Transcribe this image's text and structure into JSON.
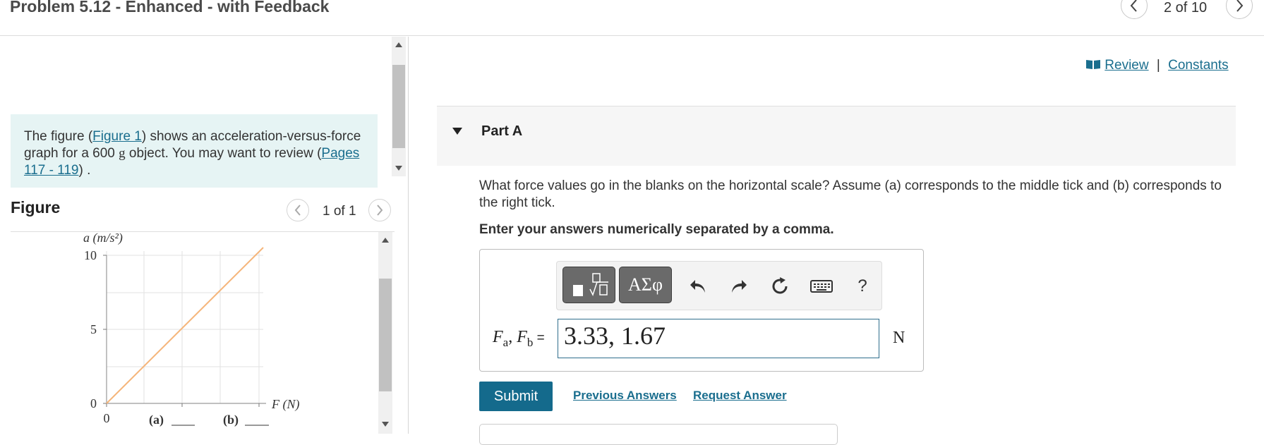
{
  "header": {
    "title": "Problem 5.12 - Enhanced - with Feedback",
    "counter": "2 of 10"
  },
  "intro": {
    "text_before": "The figure (",
    "figure_link": "Figure 1",
    "text_middle": ") shows an acceleration-versus-force graph for a 600 ",
    "unit_g": "g",
    "text_after": " object. You may want to review (",
    "pages_link": "Pages 117 - 119",
    "text_end": ") ."
  },
  "figure": {
    "heading": "Figure",
    "counter": "1 of 1",
    "graph": {
      "y_axis_label": "a (m/s²)",
      "x_axis_label": "F (N)",
      "y_ticks": [
        "10",
        "5",
        "0"
      ],
      "x_tick_zero": "0",
      "x_blank_a": "(a)",
      "x_blank_b": "(b)",
      "line_color": "#f5b57a"
    }
  },
  "links": {
    "review": "Review",
    "separator": "|",
    "constants": "Constants"
  },
  "part": {
    "title": "Part A",
    "question": "What force values go in the blanks on the horizontal scale? Assume (a) corresponds to the middle tick and (b) corresponds to the right tick.",
    "instruction": "Enter your answers numerically separated by a comma."
  },
  "toolbar": {
    "greek_key": "ΑΣφ",
    "help": "?",
    "icons": [
      "templates-icon",
      "greek-symbols-icon",
      "undo-icon",
      "redo-icon",
      "reset-icon",
      "keyboard-icon",
      "help-icon"
    ]
  },
  "answer": {
    "label_fa": "F",
    "label_fa_sub": "a",
    "label_sep": ", ",
    "label_fb": "F",
    "label_fb_sub": "b",
    "label_eq": " =",
    "value": "3.33, 1.67",
    "unit": "N"
  },
  "actions": {
    "submit": "Submit",
    "previous_answers": "Previous Answers",
    "request_answer": "Request Answer"
  },
  "colors": {
    "accent": "#146a8c",
    "link": "#1a6e8e",
    "intro_bg": "#e6f4f4"
  }
}
